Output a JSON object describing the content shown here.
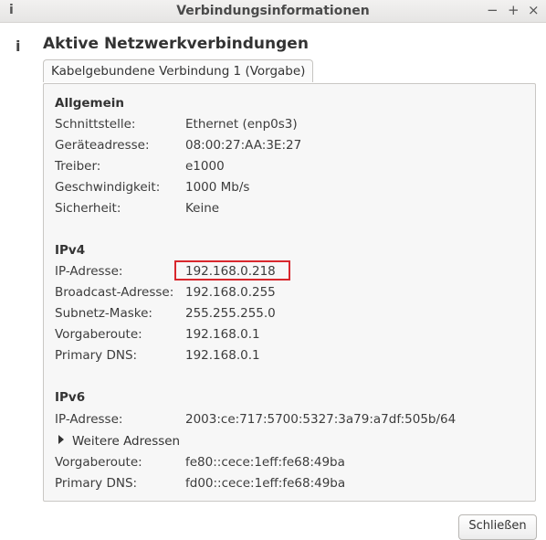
{
  "window": {
    "icon_glyph": "i",
    "title": "Verbindungsinformationen",
    "buttons": {
      "minimize": "−",
      "maximize": "+",
      "close": "×"
    }
  },
  "side_icon_glyph": "i",
  "heading": "Aktive Netzwerkverbindungen",
  "tab": {
    "label": "Kabelgebundene Verbindung 1 (Vorgabe)"
  },
  "general": {
    "title": "Allgemein",
    "rows": [
      {
        "label": "Schnittstelle:",
        "value": "Ethernet (enp0s3)"
      },
      {
        "label": "Geräteadresse:",
        "value": "08:00:27:AA:3E:27"
      },
      {
        "label": "Treiber:",
        "value": "e1000"
      },
      {
        "label": "Geschwindigkeit:",
        "value": "1000 Mb/s"
      },
      {
        "label": "Sicherheit:",
        "value": "Keine"
      }
    ]
  },
  "ipv4": {
    "title": "IPv4",
    "rows": [
      {
        "label": "IP-Adresse:",
        "value": "192.168.0.218"
      },
      {
        "label": "Broadcast-Adresse:",
        "value": "192.168.0.255"
      },
      {
        "label": "Subnetz-Maske:",
        "value": "255.255.255.0"
      },
      {
        "label": "Vorgaberoute:",
        "value": "192.168.0.1"
      },
      {
        "label": "Primary DNS:",
        "value": "192.168.0.1"
      }
    ]
  },
  "ipv6": {
    "title": "IPv6",
    "ip_label": "IP-Adresse:",
    "ip_value": "2003:ce:717:5700:5327:3a79:a7df:505b/64",
    "more_addresses": "Weitere Adressen",
    "rows": [
      {
        "label": "Vorgaberoute:",
        "value": "fe80::cece:1eff:fe68:49ba"
      },
      {
        "label": "Primary DNS:",
        "value": "fd00::cece:1eff:fe68:49ba"
      }
    ]
  },
  "colors": {
    "highlight_border": "#d8272d"
  },
  "close_button": {
    "label": "Schließen"
  }
}
